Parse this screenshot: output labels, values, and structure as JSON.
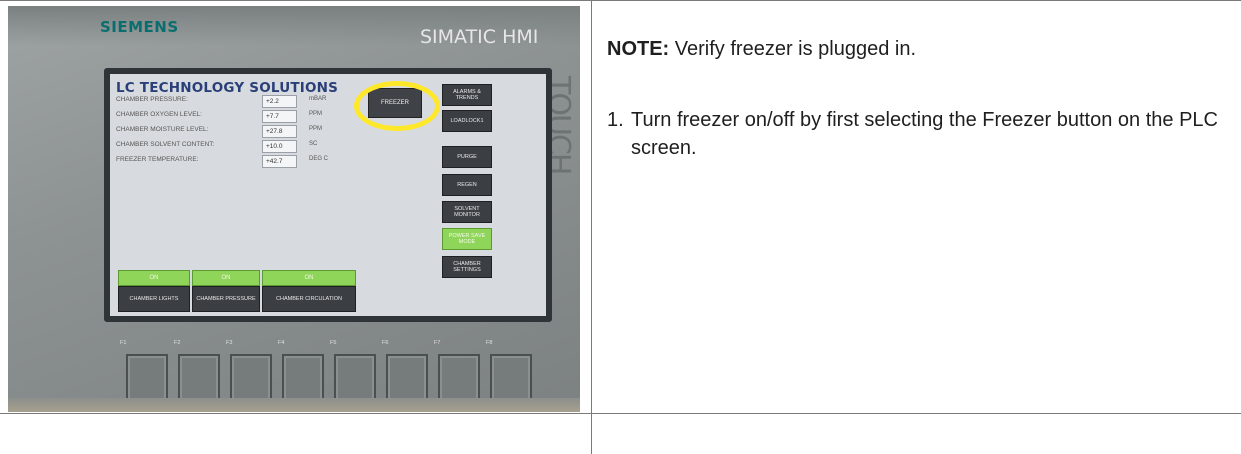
{
  "hmi": {
    "brand": "SIEMENS",
    "model": "SIMATIC HMI",
    "touch_label": "TOUCH",
    "screen": {
      "title": "LC TECHNOLOGY SOLUTIONS",
      "rows": [
        {
          "label": "CHAMBER PRESSURE:",
          "value": "+2.2",
          "unit": "mBAR"
        },
        {
          "label": "CHAMBER OXYGEN LEVEL:",
          "value": "+7.7",
          "unit": "PPM"
        },
        {
          "label": "CHAMBER MOISTURE LEVEL:",
          "value": "+27.8",
          "unit": "PPM"
        },
        {
          "label": "CHAMBER SOLVENT CONTENT:",
          "value": "+10.0",
          "unit": "SC"
        },
        {
          "label": "FREEZER TEMPERATURE:",
          "value": "+42.7",
          "unit": "DEG C"
        }
      ],
      "freezer_button": "FREEZER",
      "side_buttons": [
        "ALARMS & TRENDS",
        "LOADLOCK1",
        "PURGE",
        "REGEN",
        "SOLVENT MONITOR",
        "POWER SAVE MODE",
        "CHAMBER SETTINGS"
      ],
      "status_buttons": [
        "ON",
        "ON",
        "ON"
      ],
      "bottom_buttons": [
        "CHAMBER LIGHTS",
        "CHAMBER PRESSURE",
        "CHAMBER CIRCULATION"
      ]
    },
    "function_keys": [
      "F1",
      "F2",
      "F3",
      "F4",
      "F5",
      "F6",
      "F7",
      "F8"
    ],
    "highlight_color": "#ffe82a"
  },
  "instructions": {
    "note_label": "NOTE:",
    "note_text": " Verify freezer is plugged in.",
    "step_number": "1.",
    "step_text": "Turn freezer on/off by first selecting the Freezer button on the PLC screen."
  }
}
